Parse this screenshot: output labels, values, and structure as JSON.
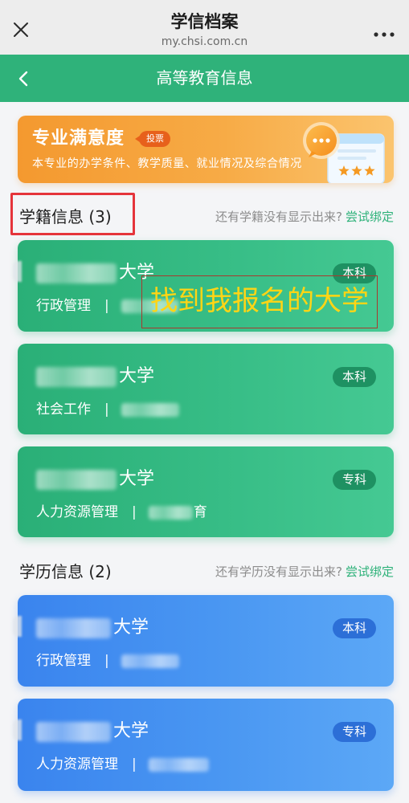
{
  "webview": {
    "title": "学信档案",
    "url": "my.chsi.com.cn",
    "close_icon": "close-icon",
    "more_icon": "more-icon"
  },
  "nav": {
    "title": "高等教育信息",
    "back_icon": "back-chevron-icon"
  },
  "banner": {
    "title": "专业满意度",
    "badge": "投票",
    "subtitle": "本专业的办学条件、教学质量、就业情况及综合情况",
    "illustration_icons": [
      "chat-bubble-icon",
      "rating-card-icon",
      "star-icon"
    ]
  },
  "enrollment_section": {
    "title": "学籍信息 (3)",
    "hint": "还有学籍没有显示出来?",
    "link": "尝试绑定"
  },
  "enrollment_records": [
    {
      "school_visible": "大学",
      "level": "本科",
      "major": "行政管理",
      "separator": "|"
    },
    {
      "school_visible": "大学",
      "level": "本科",
      "major": "社会工作",
      "separator": "|"
    },
    {
      "school_visible": "大学",
      "level": "专科",
      "major": "人力资源管理",
      "separator": "|",
      "detail_visible_tail": "育"
    }
  ],
  "degree_section": {
    "title": "学历信息 (2)",
    "hint": "还有学历没有显示出来?",
    "link": "尝试绑定"
  },
  "degree_records": [
    {
      "school_visible": "大学",
      "level": "本科",
      "major": "行政管理",
      "separator": "|"
    },
    {
      "school_visible": "大学",
      "level": "专科",
      "major": "人力资源管理",
      "separator": "|"
    }
  ],
  "annotation": {
    "callout_text": "找到我报名的大学"
  },
  "colors": {
    "header_bg": "#ededed",
    "brand_green": "#2fb27a",
    "record_blue": "#3d8ef2",
    "banner_orange": "#f6a23d",
    "annotation_red": "#e5343b",
    "callout_yellow": "#ffd515",
    "page_bg": "#f4f5f7"
  }
}
